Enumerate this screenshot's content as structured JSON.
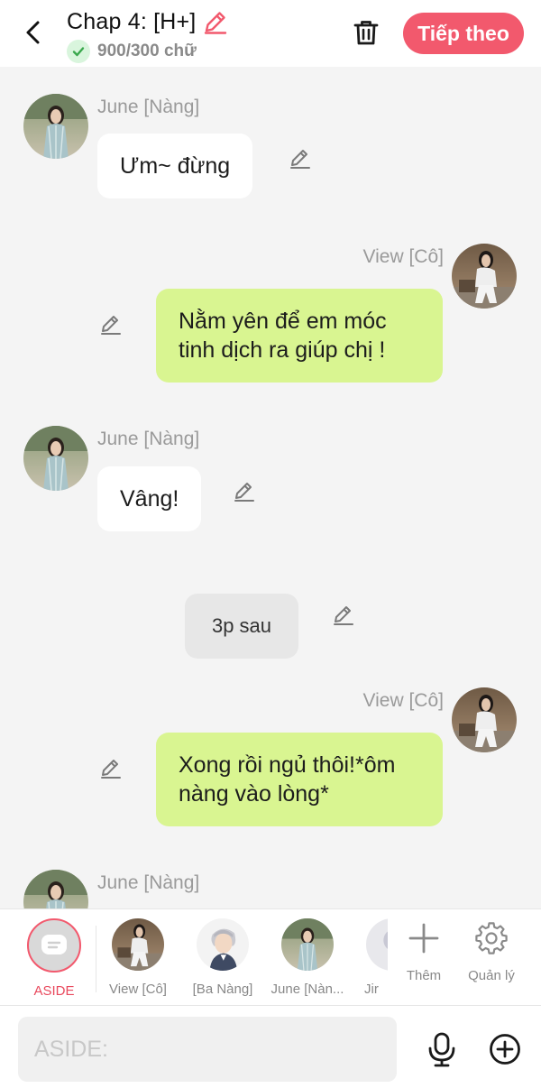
{
  "header": {
    "title": "Chap 4: [H+]",
    "word_count": "900/300 chữ",
    "next_label": "Tiếp theo"
  },
  "messages": [
    {
      "type": "character",
      "side": "left",
      "speaker": "June [Nàng]",
      "text": "Ưm~ đừng"
    },
    {
      "type": "character",
      "side": "right",
      "speaker": "View [Cô]",
      "text": "Nằm yên để em móc tinh dịch ra giúp chị !"
    },
    {
      "type": "character",
      "side": "left",
      "speaker": "June [Nàng]",
      "text": "Vâng!"
    },
    {
      "type": "aside",
      "text": "3p sau"
    },
    {
      "type": "character",
      "side": "right",
      "speaker": "View [Cô]",
      "text": "Xong rồi ngủ thôi!*ôm nàng vào lòng*"
    },
    {
      "type": "character",
      "side": "left",
      "speaker": "June [Nàng]",
      "text": ""
    }
  ],
  "characters": [
    {
      "label": "ASIDE",
      "selected": true
    },
    {
      "label": "View [Cô]"
    },
    {
      "label": "[Ba Nàng]"
    },
    {
      "label": "June [Nàn..."
    },
    {
      "label": "Jir"
    }
  ],
  "tools": {
    "add_label": "Thêm",
    "manage_label": "Quản lý"
  },
  "composer": {
    "placeholder": "ASIDE:"
  },
  "colors": {
    "accent": "#f2596d",
    "right_bubble": "#d9f591",
    "left_bubble": "#ffffff",
    "aside_bubble": "#e7e7e7"
  }
}
